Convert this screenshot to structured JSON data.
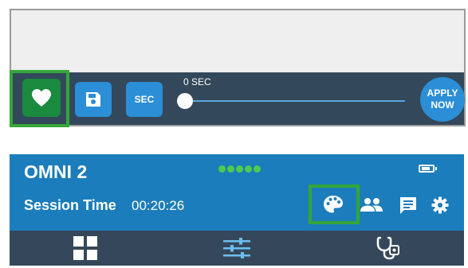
{
  "toolbar": {
    "favorite_icon": "heart-icon",
    "save_icon": "floppy-disk-icon",
    "sec_label": "SEC",
    "slider": {
      "label": "0 SEC",
      "value": 0
    },
    "apply_label_line1": "APPLY",
    "apply_label_line2": "NOW"
  },
  "header": {
    "title": "OMNI 2",
    "session_label": "Session Time",
    "session_time": "00:20:26",
    "signal_icon": "signal-dots-icon",
    "battery_icon": "battery-icon",
    "actions": [
      "palette-icon",
      "users-icon",
      "chat-icon",
      "gear-icon"
    ]
  },
  "nav": {
    "tabs": [
      "grid-icon",
      "sliders-icon",
      "stethoscope-icon"
    ]
  },
  "colors": {
    "header_bg": "#1b7dbb",
    "toolbar_bg": "#33485a",
    "accent_blue": "#2b8ed6",
    "highlight_green": "#34a638",
    "heart_green": "#1a8a3e",
    "signal_green": "#4ecb4e"
  }
}
